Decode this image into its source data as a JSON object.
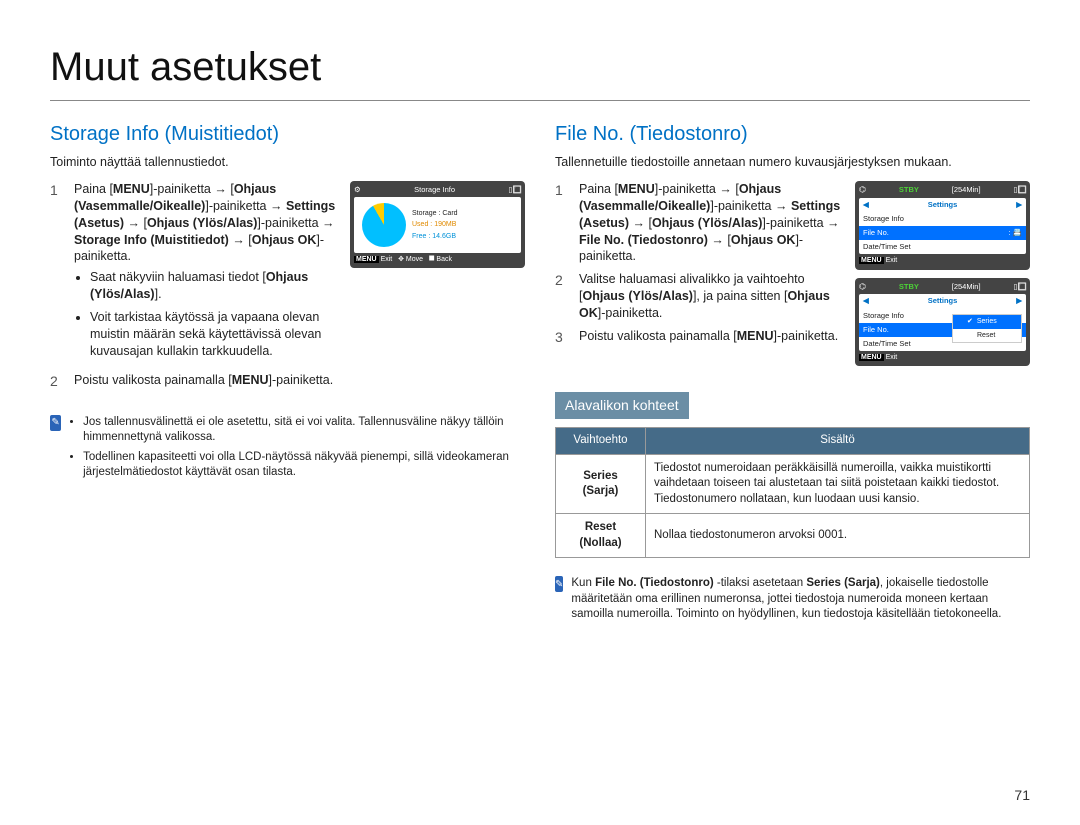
{
  "page_title": "Muut asetukset",
  "page_number": "71",
  "left": {
    "heading": "Storage Info (Muistitiedot)",
    "intro": "Toiminto näyttää tallennustiedot.",
    "step1_prefix": "Paina [",
    "menu_word": "MENU",
    "step1_suffix": "]-painiketta",
    "nav_lr": "Ohjaus (Vasemmalle/Oikealle)",
    "settings_word": "Settings (Asetus)",
    "nav_ud": "Ohjaus (Ylös/Alas)",
    "storage_info": "Storage Info (Muistitiedot)",
    "ohjaus_ok": "Ohjaus OK",
    "step1_tail": "-painiketta →",
    "step1_tail2": "-painiketta.",
    "bullet1_a": "Saat näkyviin haluamasi tiedot",
    "bullet1_b": "Ohjaus (Ylös/Alas)",
    "bullet1_c": ".",
    "bullet2": "Voit tarkistaa käytössä ja vapaana olevan muistin määrän sekä käytettävissä olevan kuvausajan kullakin tarkkuudella.",
    "step2_a": "Poistu valikosta painamalla [",
    "step2_b": "]-painiketta.",
    "note_bullets": [
      "Jos tallennusvälinettä ei ole asetettu, sitä ei voi valita. Tallennusväline näkyy tällöin himmennettynä valikossa.",
      "Todellinen kapasiteetti voi olla LCD-näytössä näkyvää pienempi, sillä videokameran järjestelmätiedostot käyttävät osan tilasta."
    ],
    "lcd": {
      "title": "Storage Info",
      "storage_lbl": "Storage",
      "storage_val": "Card",
      "used_lbl": "Used",
      "used_val": "190MB",
      "free_lbl": "Free",
      "free_val": "14.6GB",
      "exit": "Exit",
      "move": "Move",
      "back": "Back",
      "menu_tag": "MENU"
    }
  },
  "right": {
    "heading": "File No. (Tiedostonro)",
    "intro": "Tallennetuille tiedostoille annetaan numero kuvausjärjestyksen mukaan.",
    "step1_prefix": "Paina [",
    "menu_word": "MENU",
    "step1_suffix": "]-painiketta",
    "nav_lr": "Ohjaus (Vasemmalle/Oikealle)",
    "settings_word": "Settings (Asetus)",
    "nav_ud": "Ohjaus (Ylös/Alas)",
    "file_no": "File No. (Tiedostonro)",
    "ohjaus_ok": "Ohjaus OK",
    "paini_middle": "-painiketta →",
    "step1_tail2": "]-painiketta.",
    "painiketta_word": "painiketta",
    "step2": "Valitse haluamasi alivalikko ja vaihtoehto [",
    "step2_ud": "Ohjaus (Ylös/Alas)",
    "step2_mid": "], ja paina sitten [",
    "step2_ok": "Ohjaus OK",
    "step2_tail": "]-painiketta.",
    "step3_a": "Poistu valikosta painamalla [",
    "step3_b": "]-painiketta.",
    "submenu_heading": "Alavalikon kohteet",
    "table": {
      "th1": "Vaihtoehto",
      "th2": "Sisältö",
      "row1_lbl": "Series (Sarja)",
      "row1_txt": "Tiedostot numeroidaan peräkkäisillä numeroilla, vaikka muistikortti vaihdetaan toiseen tai alustetaan tai siitä poistetaan kaikki tiedostot. Tiedostonumero nollataan, kun luodaan uusi kansio.",
      "row2_lbl": "Reset (Nollaa)",
      "row2_txt": "Nollaa tiedostonumeron arvoksi 0001."
    },
    "note_prefix": "Kun ",
    "note_bold1": "File No. (Tiedostonro)",
    "note_mid1": " -tilaksi asetetaan ",
    "note_bold2": "Series (Sarja)",
    "note_tail": ", jokaiselle tiedostolle määritetään oma erillinen numeronsa, jottei tiedostoja numeroida moneen kertaan samoilla numeroilla. Toiminto on hyödyllinen, kun tiedostoja käsitellään tietokoneella.",
    "lcd1": {
      "stby": "STBY",
      "time": "254Min",
      "settings": "Settings",
      "items": [
        "Storage Info",
        "File No.",
        "Date/Time Set"
      ],
      "selected": "File No.",
      "exit": "Exit",
      "menu_tag": "MENU"
    },
    "lcd2": {
      "stby": "STBY",
      "time": "254Min",
      "settings": "Settings",
      "items": [
        "Storage Info",
        "File No.",
        "Date/Time Set"
      ],
      "selected": "File No.",
      "sub": {
        "series": "Series",
        "reset": "Reset"
      },
      "exit": "Exit",
      "menu_tag": "MENU"
    }
  }
}
